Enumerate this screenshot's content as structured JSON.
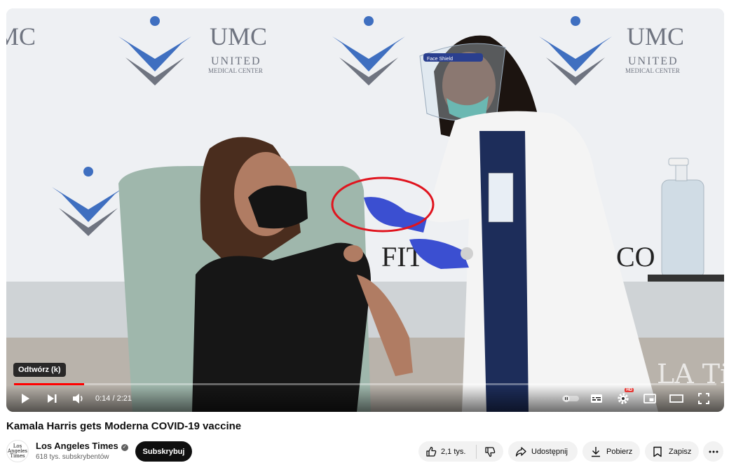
{
  "player": {
    "tooltip": "Odtwórz (k)",
    "time": "0:14 / 2:21",
    "progress": 0.1,
    "hd_badge": "HD",
    "watermark": "LA Times",
    "backdrop_brand": {
      "short": "UMC",
      "line1": "UNITED",
      "line2": "MEDICAL CENTER"
    },
    "face_shield_text": "Face Shield",
    "wall_text_left": "FIT",
    "wall_text_right": "CO",
    "icons": [
      "play-icon",
      "next-icon",
      "volume-icon",
      "autoplay-toggle-icon",
      "captions-icon",
      "settings-icon",
      "miniplayer-icon",
      "theater-mode-icon",
      "fullscreen-icon"
    ],
    "highlight_color": "#e0141e",
    "progress_color": "#ff0000"
  },
  "video": {
    "title": "Kamala Harris gets Moderna COVID-19 vaccine"
  },
  "channel": {
    "avatar_text_1": "Los",
    "avatar_text_2": "Angeles",
    "avatar_text_3": "Times",
    "name": "Los Angeles Times",
    "subscribers": "618 tys. subskrybentów",
    "subscribe_label": "Subskrybuj"
  },
  "actions": {
    "likes": "2,1 tys.",
    "share_label": "Udostępnij",
    "download_label": "Pobierz",
    "save_label": "Zapisz"
  }
}
